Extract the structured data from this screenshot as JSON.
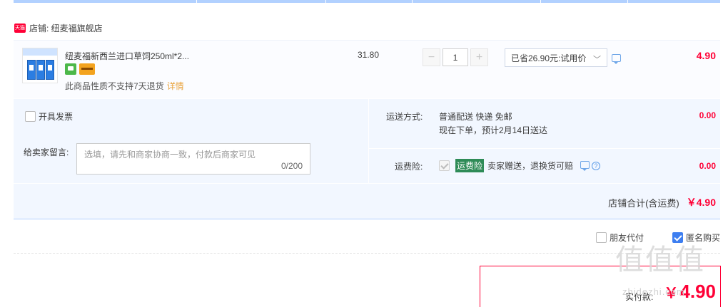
{
  "shop": {
    "badge": "天猫",
    "label": "店铺: 纽麦福旗舰店"
  },
  "item": {
    "title": "纽麦福新西兰进口草饲250ml*2...",
    "return_note": "此商品性质不支持7天退货",
    "detail_link": "详情",
    "unit_price": "31.80",
    "quantity": "1",
    "promo": "已省26.90元:试用价",
    "subtotal": "4.90"
  },
  "options": {
    "invoice_label": "开具发票",
    "memo_label": "给卖家留言:",
    "memo_placeholder": "选填，请先和商家协商一致，付款后商家可见",
    "memo_count": "0/200",
    "shipping_label": "运送方式:",
    "shipping_method": "普通配送 快递 免邮",
    "shipping_eta": "现在下单，预计2月14日送达",
    "shipping_fee": "0.00",
    "insurance_label": "运费险:",
    "insurance_badge": "运费险",
    "insurance_text": "卖家赠送，退换货可赔",
    "insurance_fee": "0.00"
  },
  "shop_total": {
    "label": "店铺合计(含运费)",
    "amount": "￥4.90"
  },
  "pay_options": {
    "friend_pay": "朋友代付",
    "anonymous": "匿名购买"
  },
  "final": {
    "label": "实付款:",
    "currency": "￥",
    "amount": "4.90"
  },
  "watermark": {
    "main": "值值值",
    "url": "zhidezhi.com"
  },
  "colors": {
    "accent_red": "#ff0036",
    "accent_blue": "#3d7ef0",
    "panel_bg": "#f2f7ff"
  }
}
